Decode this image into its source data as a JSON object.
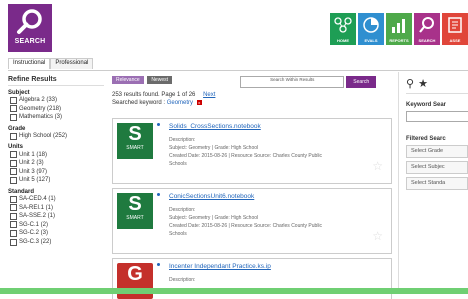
{
  "header": {
    "logo_label": "SEARCH",
    "nav": [
      {
        "label": "HOME",
        "color": "#1e9e55",
        "icon": "network-icon"
      },
      {
        "label": "EVALS",
        "color": "#2f8fd0",
        "icon": "pie-chart-icon"
      },
      {
        "label": "REPORTS",
        "color": "#4ea94a",
        "icon": "bar-chart-icon"
      },
      {
        "label": "SEARCH",
        "color": "#a8328a",
        "icon": "search-icon"
      },
      {
        "label": "ASSE",
        "color": "#e0463a",
        "icon": "assess-icon"
      }
    ]
  },
  "tabs": [
    "Instructional",
    "Professional"
  ],
  "refine": {
    "title": "Refine Results",
    "groups": [
      {
        "label": "Subject",
        "options": [
          "Algebra 2 (33)",
          "Geometry (218)",
          "Mathematics (3)"
        ]
      },
      {
        "label": "Grade",
        "options": [
          "High School (252)"
        ]
      },
      {
        "label": "Units",
        "options": [
          "Unit 1 (18)",
          "Unit 2 (3)",
          "Unit 3 (97)",
          "Unit 5 (127)"
        ]
      },
      {
        "label": "Standard",
        "options": [
          "SA-CED.4 (1)",
          "SA-REI.1 (1)",
          "SA-SSE.2 (1)",
          "SG-C.1 (2)",
          "SG-C.2 (3)",
          "SG-C.3 (22)"
        ]
      }
    ]
  },
  "results": {
    "sort_relevance": "Relevance",
    "sort_newest": "Newest",
    "search_placeholder": "Search Within Results",
    "search_button": "Search",
    "count_text": "253 results found. Page 1 of 26",
    "next_label": "Next",
    "keyword_label": "Searched keyword :",
    "keyword_value": "Geometry",
    "keyword_remove": "x",
    "items": [
      {
        "title": "Solids_CrossSections.notebook",
        "thumb_letter": "S",
        "thumb_sub": "SMART",
        "desc_label": "Description:",
        "meta1": "Subject: Geometry | Grade: High School",
        "meta2": "Created Date: 2015-08-26 | Resource Source: Charles County Public",
        "meta3": "Schools"
      },
      {
        "title": "ConicSectionsUnit6.notebook",
        "thumb_letter": "S",
        "thumb_sub": "SMART",
        "desc_label": "Description:",
        "meta1": "Subject: Geometry | Grade: High School",
        "meta2": "Created Date: 2015-08-26 | Resource Source: Charles County Public",
        "meta3": "Schools"
      },
      {
        "title": "Incenter Independant Practice.ks.ip",
        "thumb_letter": "G",
        "thumb_sub": "",
        "desc_label": "Description:"
      }
    ]
  },
  "sidebar_right": {
    "keyword_search_label": "Keyword Sear",
    "filtered_search_label": "Filtered Searc",
    "selects": [
      "Select Grade",
      "Select Subjec",
      "Select Standa"
    ]
  }
}
